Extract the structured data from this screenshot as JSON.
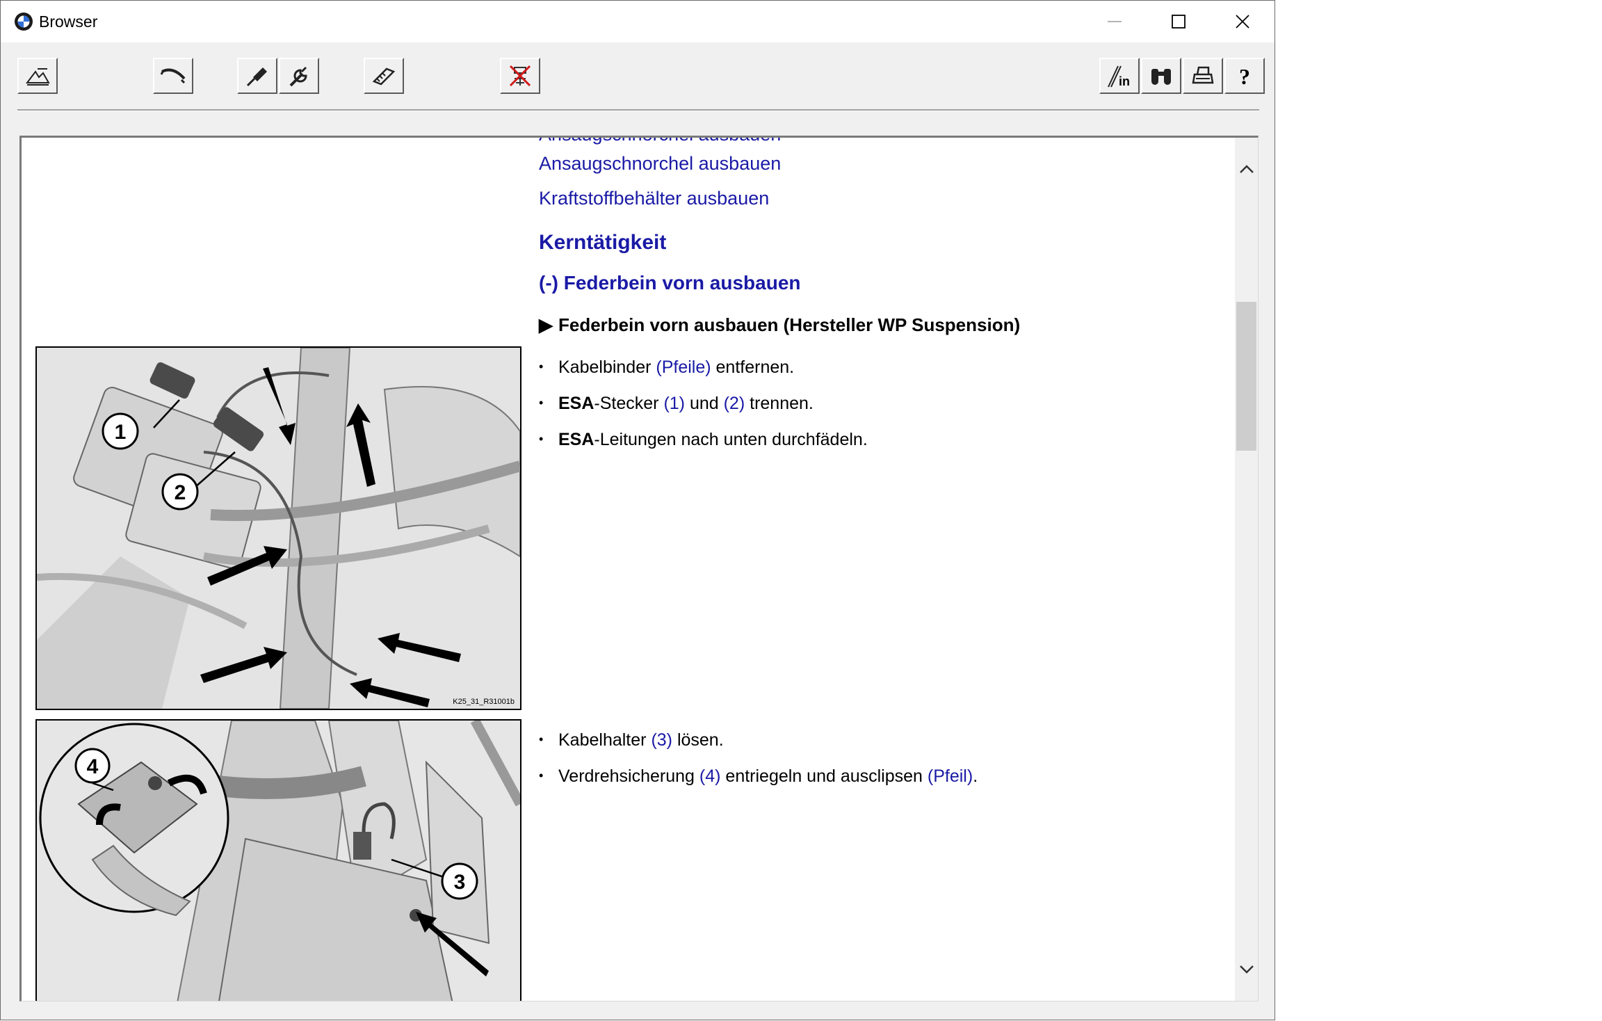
{
  "window": {
    "title": "Browser",
    "controls": {
      "minimize": "minimize",
      "maximize": "maximize",
      "close": "close"
    }
  },
  "toolbar": {
    "left_buttons": [
      {
        "name": "vehicle-select",
        "icon": "vehicle-select-icon"
      },
      {
        "name": "service-functions",
        "icon": "hose-icon"
      },
      {
        "name": "diagnosis",
        "icon": "probe-icon"
      },
      {
        "name": "repair",
        "icon": "wrench-icon"
      },
      {
        "name": "technical-data",
        "icon": "tape-icon"
      },
      {
        "name": "wiring-diagram",
        "icon": "circuit-icon"
      }
    ],
    "right_buttons": [
      {
        "name": "info",
        "icon": "info-in-icon",
        "label": "in"
      },
      {
        "name": "search",
        "icon": "binoculars-icon"
      },
      {
        "name": "print",
        "icon": "printer-icon"
      },
      {
        "name": "help",
        "icon": "question-icon",
        "label": "?"
      }
    ]
  },
  "document": {
    "links": [
      "Ansaugschnorchel ausbauen",
      "Kraftstoffbehälter ausbauen"
    ],
    "section_heading": "Kerntätigkeit",
    "subsection_heading": "(-) Federbein vorn ausbauen",
    "procedure": {
      "marker": "▶",
      "title": "Federbein vorn ausbauen (Hersteller WP Suspension)"
    },
    "steps_group1": [
      {
        "pre": "Kabelbinder ",
        "ref": "(Pfeile)",
        "post": " entfernen."
      },
      {
        "bold": "ESA",
        "pre": "-Stecker ",
        "ref": "(1)",
        "mid": " und ",
        "ref2": "(2)",
        "post": " trennen."
      },
      {
        "bold": "ESA",
        "pre": "-Leitungen nach unten durchfädeln."
      }
    ],
    "steps_group2": [
      {
        "pre": "Kabelhalter ",
        "ref": "(3)",
        "post": " lösen."
      },
      {
        "pre": "Verdrehsicherung ",
        "ref": "(4)",
        "mid": " entriegeln und ausclipsen ",
        "ref2": "(Pfeil)",
        "post": "."
      }
    ],
    "figure1": {
      "code": "K25_31_R31001b",
      "callouts": [
        "1",
        "2"
      ]
    },
    "figure2": {
      "callouts": [
        "3",
        "4"
      ]
    }
  },
  "colors": {
    "link": "#1a1aa6",
    "window_bg": "#f0f0f0",
    "content_bg": "#ffffff"
  }
}
